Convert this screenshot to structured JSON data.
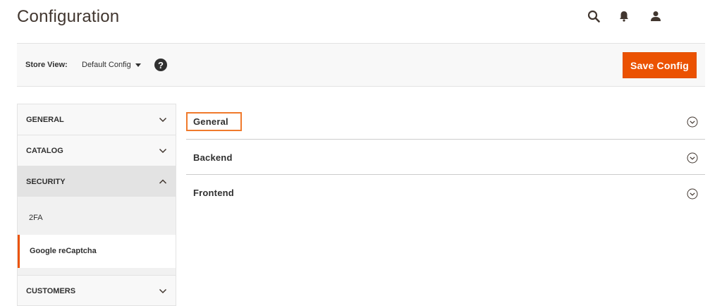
{
  "page": {
    "title": "Configuration"
  },
  "header": {
    "icons": [
      "search-icon",
      "bell-icon",
      "user-icon"
    ]
  },
  "store_bar": {
    "label": "Store View:",
    "selected": "Default Config",
    "help_glyph": "?",
    "save_label": "Save Config"
  },
  "sidebar": {
    "tabs": [
      {
        "label": "GENERAL",
        "expanded": false
      },
      {
        "label": "CATALOG",
        "expanded": false
      },
      {
        "label": "SECURITY",
        "expanded": true
      },
      {
        "label": "CUSTOMERS",
        "expanded": false
      }
    ],
    "security_items": [
      "2FA",
      "Google reCaptcha"
    ],
    "current_item": "Google reCaptcha"
  },
  "sections": [
    {
      "title": "General"
    },
    {
      "title": "Backend"
    },
    {
      "title": "Frontend"
    }
  ],
  "colors": {
    "accent": "#eb5202",
    "highlight": "#f07a2c",
    "text": "#303030",
    "panel": "#f8f8f8"
  }
}
